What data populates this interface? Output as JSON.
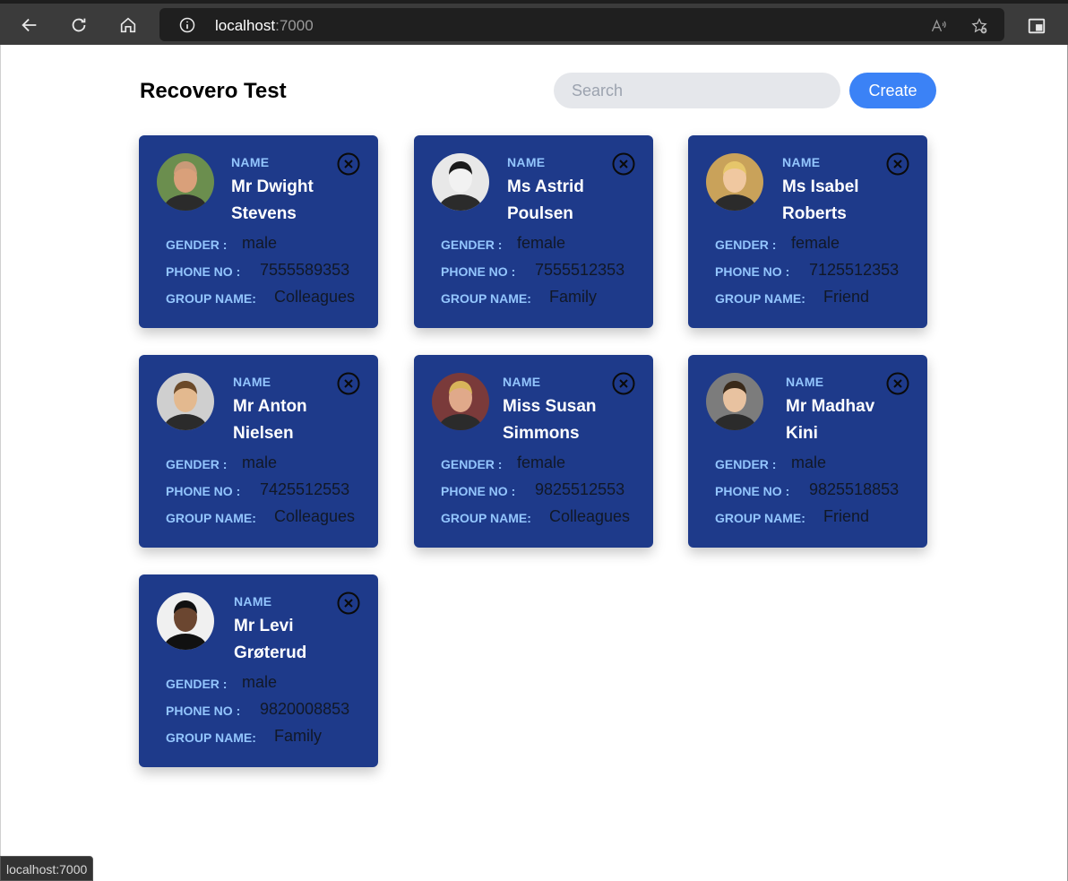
{
  "browser": {
    "url_host": "localhost",
    "url_port": ":7000",
    "status_text": "localhost:7000"
  },
  "header": {
    "title": "Recovero Test",
    "search_placeholder": "Search",
    "create_label": "Create"
  },
  "labels": {
    "name": "NAME",
    "gender": "GENDER :",
    "phone": "PHONE NO :",
    "group": "GROUP NAME:"
  },
  "contacts": [
    {
      "name": "Mr Dwight Stevens",
      "gender": "male",
      "phone": "7555589353",
      "group": "Colleagues",
      "avatar_color": "#6b8e4e"
    },
    {
      "name": "Ms Astrid Poulsen",
      "gender": "female",
      "phone": "7555512353",
      "group": "Family",
      "avatar_color": "#e8e8e8"
    },
    {
      "name": "Ms Isabel Roberts",
      "gender": "female",
      "phone": "7125512353",
      "group": "Friend",
      "avatar_color": "#c9a25a"
    },
    {
      "name": "Mr Anton Nielsen",
      "gender": "male",
      "phone": "7425512553",
      "group": "Colleagues",
      "avatar_color": "#cfcfcf"
    },
    {
      "name": "Miss Susan Simmons",
      "gender": "female",
      "phone": "9825512553",
      "group": "Colleagues",
      "avatar_color": "#7a3a3a"
    },
    {
      "name": "Mr Madhav Kini",
      "gender": "male",
      "phone": "9825518853",
      "group": "Friend",
      "avatar_color": "#7c7c7c"
    },
    {
      "name": "Mr Levi Grøterud",
      "gender": "male",
      "phone": "9820008853",
      "group": "Family",
      "avatar_color": "#f0f0f0"
    }
  ],
  "colors": {
    "card_bg": "#1e3a8a",
    "label": "#93c5fd",
    "create_button": "#3b82f6"
  }
}
